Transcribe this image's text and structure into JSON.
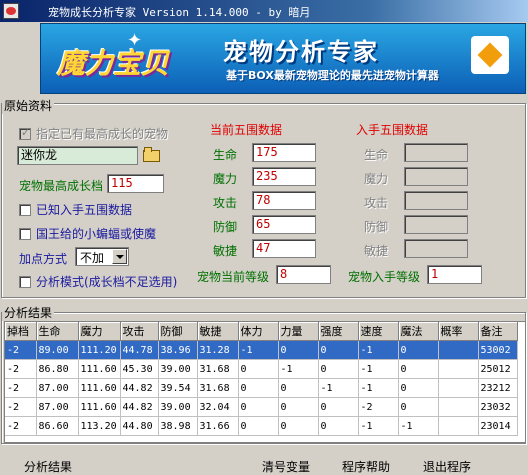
{
  "window": {
    "title": "宠物成长分析专家 Version 1.14.000 - by 暗月"
  },
  "banner": {
    "logo": "魔力宝贝",
    "title": "宠物分析专家",
    "subtitle": "基于BOX最新宠物理论的最先进宠物计算器"
  },
  "original": {
    "title": "原始资料",
    "designate_max_label": "指定已有最高成长的宠物",
    "pet_name": "迷你龙",
    "max_growth_label": "宠物最高成长档",
    "max_growth_value": "115",
    "known_stats_label": "已知入手五围数据",
    "king_label": "国王给的小蝙蝠或使魔",
    "addpoint_label": "加点方式",
    "addpoint_value": "不加",
    "analysis_mode_label": "分析模式(成长档不足选用)",
    "current_title": "当前五围数据",
    "initial_title": "入手五围数据",
    "stats": [
      {
        "label": "生命",
        "current": "175",
        "initial": ""
      },
      {
        "label": "魔力",
        "current": "235",
        "initial": ""
      },
      {
        "label": "攻击",
        "current": "78",
        "initial": ""
      },
      {
        "label": "防御",
        "current": "65",
        "initial": ""
      },
      {
        "label": "敏捷",
        "current": "47",
        "initial": ""
      }
    ],
    "current_level_label": "宠物当前等级",
    "current_level_value": "8",
    "initial_level_label": "宠物入手等级",
    "initial_level_value": "1"
  },
  "results": {
    "title": "分析结果",
    "columns": [
      "掉档",
      "生命",
      "魔力",
      "攻击",
      "防御",
      "敏捷",
      "体力",
      "力量",
      "强度",
      "速度",
      "魔法",
      "概率",
      "备注"
    ],
    "rows": [
      [
        "-2",
        "89.00",
        "111.20",
        "44.78",
        "38.96",
        "31.28",
        "-1",
        "0",
        "0",
        "-1",
        "0",
        "",
        "53002"
      ],
      [
        "-2",
        "86.80",
        "111.60",
        "45.30",
        "39.00",
        "31.68",
        "0",
        "-1",
        "0",
        "-1",
        "0",
        "",
        "25012"
      ],
      [
        "-2",
        "87.00",
        "111.60",
        "44.82",
        "39.54",
        "31.68",
        "0",
        "0",
        "-1",
        "-1",
        "0",
        "",
        "23212"
      ],
      [
        "-2",
        "87.00",
        "111.60",
        "44.82",
        "39.00",
        "32.04",
        "0",
        "0",
        "0",
        "-2",
        "0",
        "",
        "23032"
      ],
      [
        "-2",
        "86.60",
        "113.20",
        "44.80",
        "38.98",
        "31.66",
        "0",
        "0",
        "0",
        "-1",
        "-1",
        "",
        "23014"
      ]
    ]
  },
  "buttons": {
    "analyze": "分析结果",
    "clear": "清号变量",
    "help": "程序帮助",
    "exit": "退出程序"
  }
}
